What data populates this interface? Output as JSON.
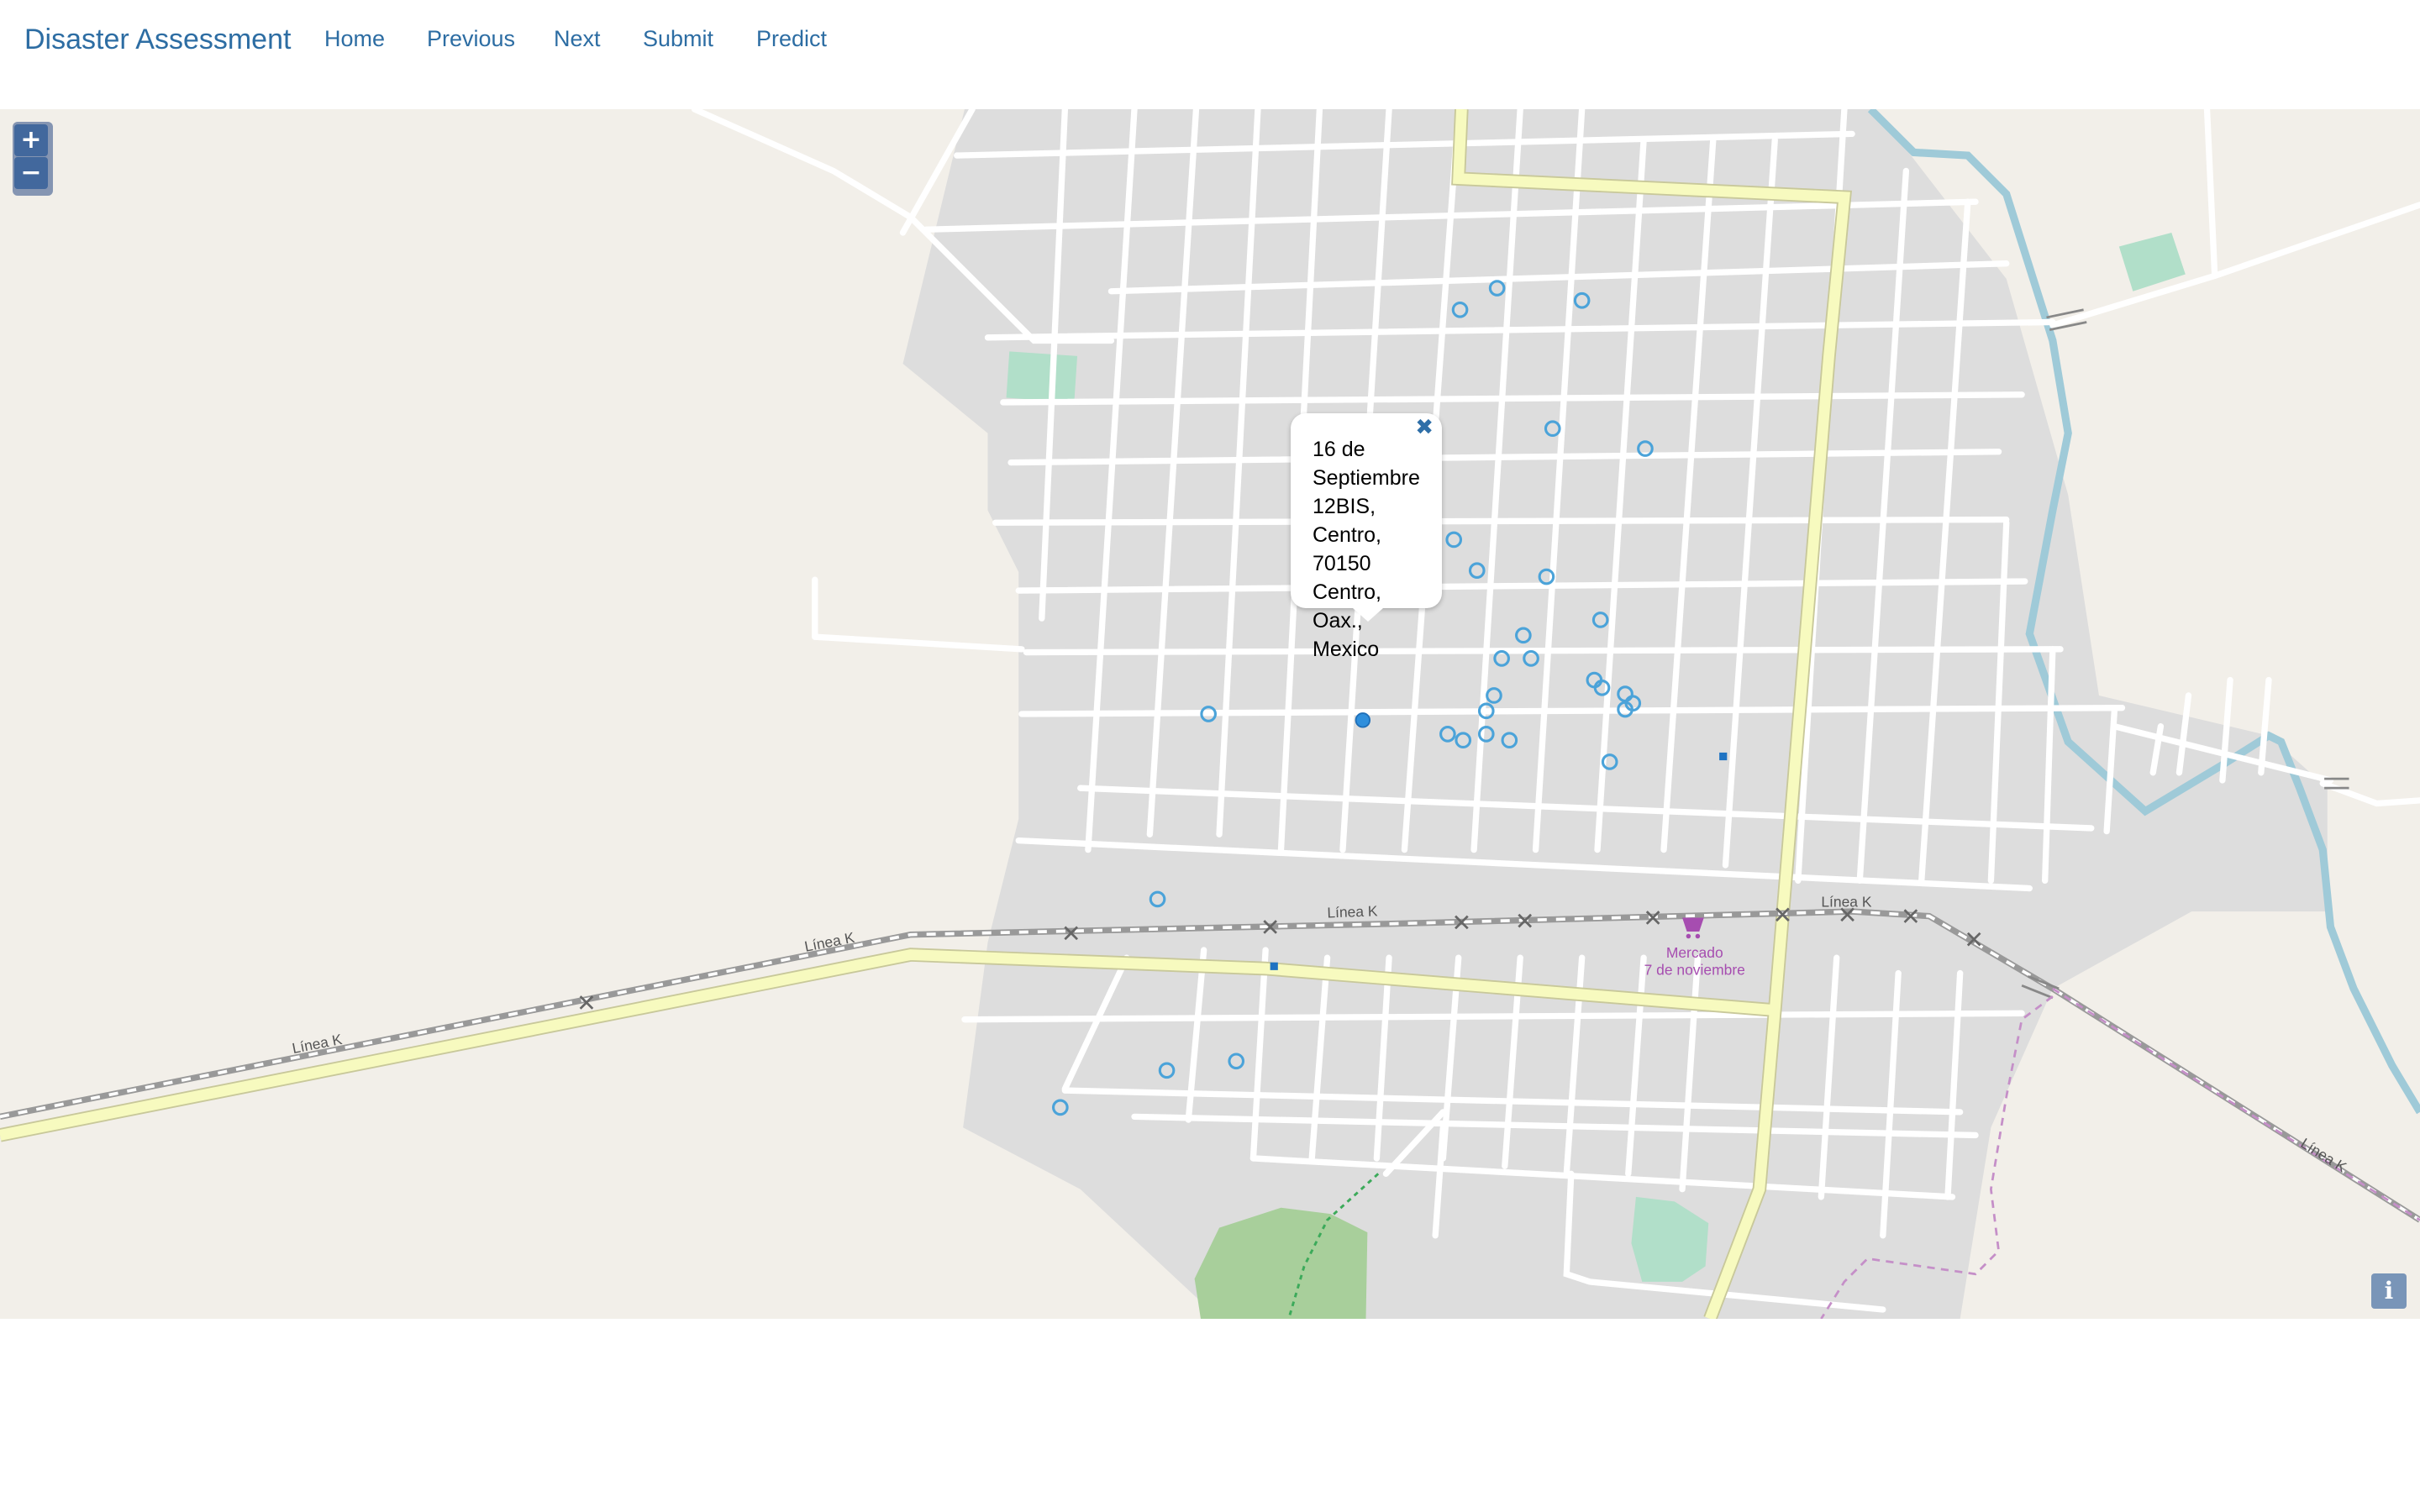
{
  "navbar": {
    "brand": "Disaster Assessment",
    "links": [
      "Home",
      "Previous",
      "Next",
      "Submit",
      "Predict"
    ]
  },
  "map": {
    "zoom_in": "+",
    "zoom_out": "−",
    "info": "i",
    "popup": {
      "close": "✖",
      "lines": [
        "16 de",
        "Septiembre",
        "12BIS,",
        "Centro,",
        "70150",
        "Centro,",
        "Oax.,",
        "Mexico"
      ]
    },
    "labels": {
      "railway_1": "Línea K",
      "railway_2": "Línea K",
      "railway_3": "Línea K",
      "railway_4": "Línea K",
      "railway_5": "Línea K",
      "market_line1": "Mercado",
      "market_line2": "7 de noviembre"
    },
    "colors": {
      "land": "#f2efe9",
      "urban": "#dddddd",
      "street": "#ffffff",
      "highway": "#f7fabf",
      "river": "#aad3df",
      "park": "#b5e3cc",
      "forest": "#add19e",
      "marker": "#3a9ad9",
      "poi": "#a64db0"
    }
  }
}
